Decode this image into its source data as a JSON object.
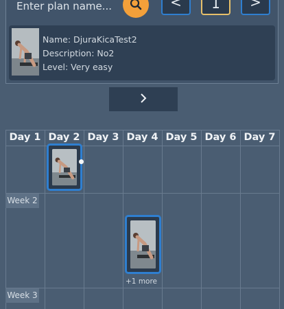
{
  "search": {
    "placeholder": "Enter plan name..."
  },
  "pager": {
    "prev_label": "<",
    "page": "1",
    "next_label": ">"
  },
  "plan": {
    "name": "Name: DjuraKicaTest2",
    "description": "Description: No2",
    "level": "Level: Very easy"
  },
  "calendar": {
    "days": [
      "Day 1",
      "Day 2",
      "Day 3",
      "Day 4",
      "Day 5",
      "Day 6",
      "Day 7"
    ],
    "weeks": [
      "Week 2",
      "Week 3"
    ],
    "more_label": "+1 more"
  },
  "colors": {
    "background": "#4a5d72",
    "accent_orange": "#f3a03a",
    "accent_blue": "#2f7fd0",
    "accent_gold": "#e7c06a"
  }
}
